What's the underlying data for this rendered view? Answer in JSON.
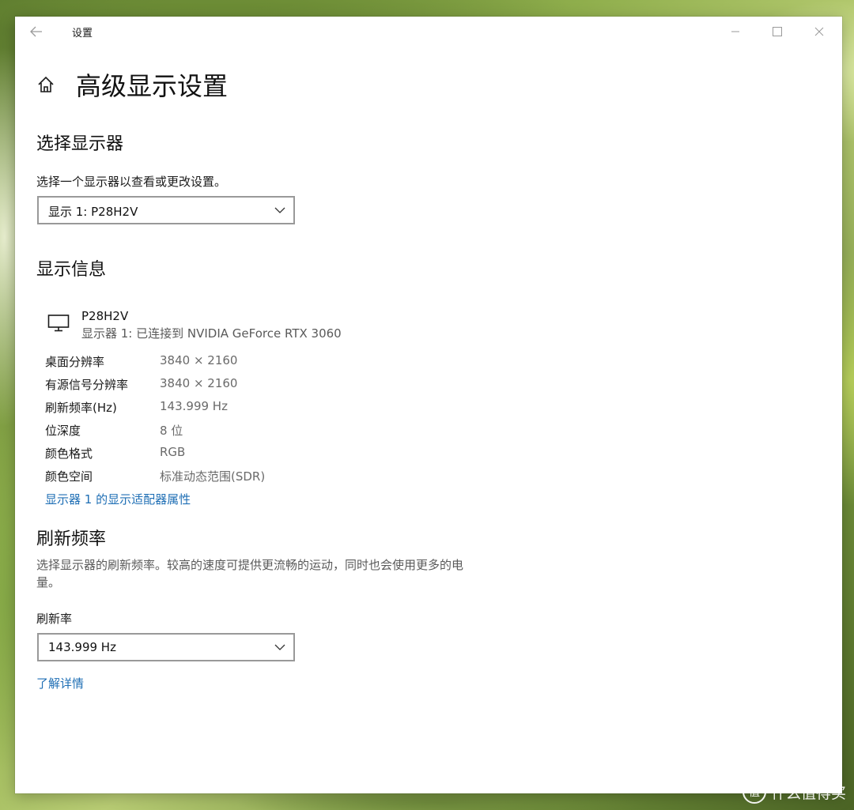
{
  "window": {
    "app_title": "设置",
    "page_title": "高级显示设置"
  },
  "icons": {
    "back": "back-arrow-icon",
    "minimize": "minimize-icon",
    "maximize": "maximize-icon",
    "close": "close-icon",
    "home": "home-icon",
    "monitor": "monitor-icon",
    "dropdown": "chevron-down-icon"
  },
  "select_display": {
    "heading": "选择显示器",
    "description": "选择一个显示器以查看或更改设置。",
    "selected": "显示 1: P28H2V"
  },
  "display_info": {
    "heading": "显示信息",
    "monitor_name": "P28H2V",
    "monitor_sub": "显示器 1: 已连接到 NVIDIA GeForce RTX 3060",
    "rows": [
      {
        "label": "桌面分辨率",
        "value": "3840 × 2160"
      },
      {
        "label": "有源信号分辨率",
        "value": "3840 × 2160"
      },
      {
        "label": "刷新频率(Hz)",
        "value": "143.999 Hz"
      },
      {
        "label": "位深度",
        "value": "8 位"
      },
      {
        "label": "颜色格式",
        "value": "RGB"
      },
      {
        "label": "颜色空间",
        "value": "标准动态范围(SDR)"
      }
    ],
    "adapter_link": "显示器 1 的显示适配器属性"
  },
  "refresh": {
    "heading": "刷新频率",
    "description": "选择显示器的刷新频率。较高的速度可提供更流畅的运动，同时也会使用更多的电量。",
    "rate_label": "刷新率",
    "selected": "143.999 Hz",
    "learn_more": "了解详情"
  },
  "watermark": {
    "logo_text": "值",
    "text": "什么值得买"
  },
  "colors": {
    "link": "#1f6fb5",
    "window_bg": "#ffffff"
  }
}
